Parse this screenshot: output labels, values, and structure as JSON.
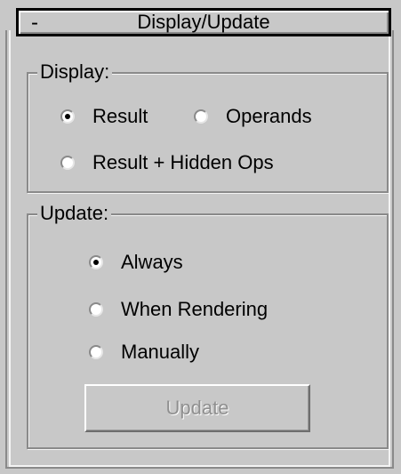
{
  "rollout": {
    "collapse_symbol": "-",
    "title": "Display/Update"
  },
  "display_group": {
    "label": "Display:",
    "options": [
      {
        "label": "Result",
        "checked": true
      },
      {
        "label": "Operands",
        "checked": false
      },
      {
        "label": "Result + Hidden Ops",
        "checked": false
      }
    ]
  },
  "update_group": {
    "label": "Update:",
    "options": [
      {
        "label": "Always",
        "checked": true
      },
      {
        "label": "When Rendering",
        "checked": false
      },
      {
        "label": "Manually",
        "checked": false
      }
    ],
    "button_label": "Update",
    "button_enabled": false
  }
}
